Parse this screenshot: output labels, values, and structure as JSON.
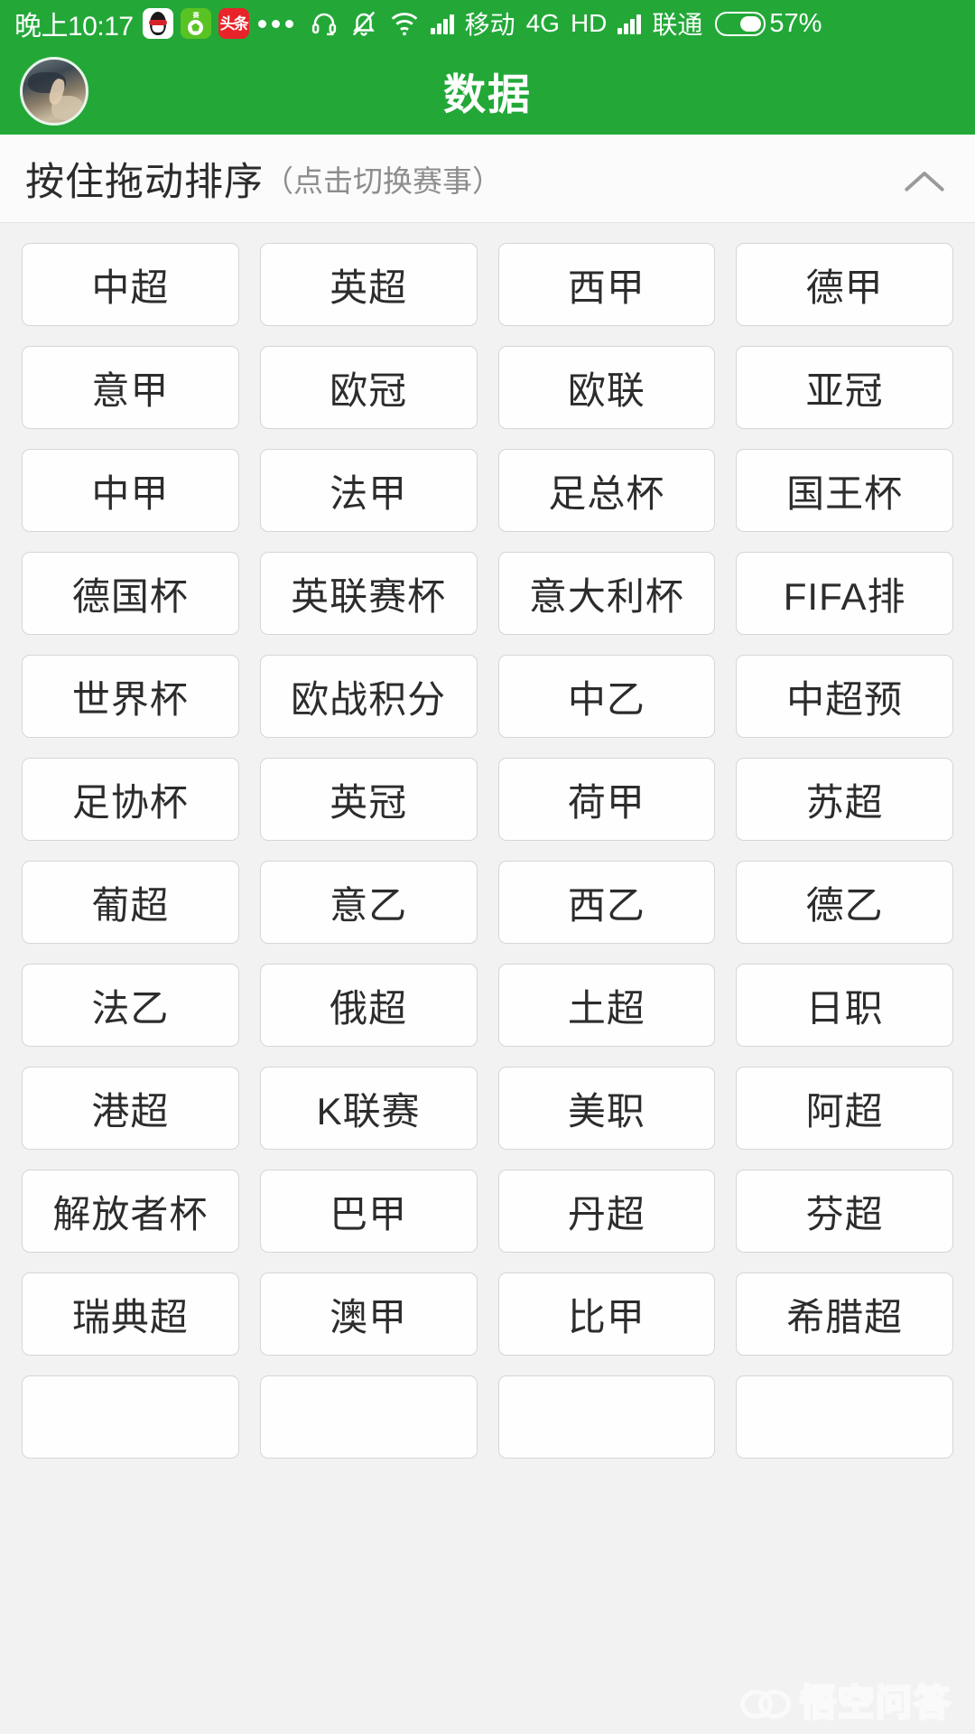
{
  "status_bar": {
    "time": "晚上10:17",
    "app_icons": [
      "qq-icon",
      "football-app-icon",
      "toutiao-icon"
    ],
    "overflow_dots": "...",
    "headset_icon": "headset-icon",
    "mute_bell_icon": "bell-muted-icon",
    "wifi_icon": "wifi-icon",
    "carrier_1": "移动",
    "network_type": "4G",
    "hd_label": "HD",
    "carrier_2": "联通",
    "battery_percent": "57%"
  },
  "app_bar": {
    "title": "数据",
    "avatar": "user-avatar"
  },
  "section_header": {
    "main_text": "按住拖动排序",
    "sub_text": "（点击切换赛事）",
    "collapse_icon": "chevron-up-icon"
  },
  "leagues": [
    "中超",
    "英超",
    "西甲",
    "德甲",
    "意甲",
    "欧冠",
    "欧联",
    "亚冠",
    "中甲",
    "法甲",
    "足总杯",
    "国王杯",
    "德国杯",
    "英联赛杯",
    "意大利杯",
    "FIFA排",
    "世界杯",
    "欧战积分",
    "中乙",
    "中超预",
    "足协杯",
    "英冠",
    "荷甲",
    "苏超",
    "葡超",
    "意乙",
    "西乙",
    "德乙",
    "法乙",
    "俄超",
    "土超",
    "日职",
    "港超",
    "K联赛",
    "美职",
    "阿超",
    "解放者杯",
    "巴甲",
    "丹超",
    "芬超",
    "瑞典超",
    "澳甲",
    "比甲",
    "希腊超",
    "",
    "",
    "",
    ""
  ],
  "watermark": {
    "text": "悟空问答"
  },
  "colors": {
    "brand_green": "#23a838",
    "page_background": "#f2f2f2",
    "tile_background": "#fefefe",
    "tile_border": "#d6d6d6",
    "text_primary": "#2c2c2c",
    "text_muted": "#8d8d8d"
  }
}
